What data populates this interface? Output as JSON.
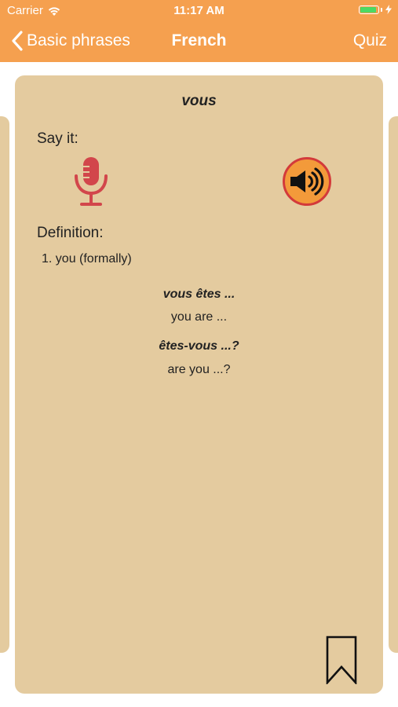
{
  "status_bar": {
    "carrier": "Carrier",
    "time": "11:17 AM",
    "battery_color": "#4cd964"
  },
  "nav": {
    "back_label": "Basic phrases",
    "title": "French",
    "quiz_label": "Quiz"
  },
  "card": {
    "word": "vous",
    "say_label": "Say it:",
    "mic_icon": "microphone-icon",
    "speaker_icon": "speaker-icon",
    "definition_label": "Definition:",
    "definitions": [
      "1. you (formally)"
    ],
    "examples": [
      {
        "phrase": "vous êtes ...",
        "translation": "you are ..."
      },
      {
        "phrase": "êtes-vous ...?",
        "translation": "are you ...?"
      }
    ],
    "bookmark_icon": "bookmark-icon"
  },
  "colors": {
    "header": "#f5a04f",
    "card": "#e4cb9f",
    "mic": "#d2464b",
    "speaker_fill": "#f39a3a",
    "speaker_ring": "#d33a3a"
  }
}
